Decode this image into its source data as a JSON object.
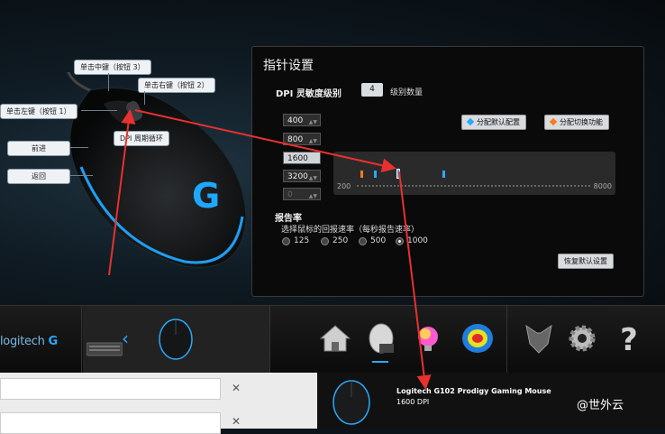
{
  "callouts": {
    "left_button": "单击左键（按钮 1）",
    "middle_button": "单击中键（按钮 3）",
    "right_button": "单击右键（按钮 2）",
    "dpi_cycle": "DPI 周期循环",
    "forward": "前进",
    "back": "返回"
  },
  "panel": {
    "title": "指针设置",
    "dpi_level_label": "DPI 灵敏度级别",
    "dpi_count": "4",
    "dpi_count_label": "级别数量",
    "dpi_levels": [
      "400",
      "800",
      "1600",
      "3200",
      "0"
    ],
    "selected_level_index": 2,
    "assign_default_label": "分配默认配置",
    "assign_shift_label": "分配切换功能",
    "slider_min": "200",
    "slider_max": "8000",
    "report_rate_title": "报告率",
    "report_rate_sub": "选择鼠标的回报速率（每秒报告速率）",
    "rates": [
      "125",
      "250",
      "500",
      "1000"
    ],
    "selected_rate": "1000",
    "restore_default_label": "恢复默认设置"
  },
  "bottom_bar": {
    "logo_text": "logitech",
    "icons": [
      "home-icon",
      "mouse-pointer-settings-icon",
      "lighting-icon",
      "heatmap-icon",
      "arx-control-icon",
      "settings-gear-icon",
      "help-icon"
    ]
  },
  "notification": {
    "device_name": "Logitech G102 Prodigy Gaming Mouse",
    "dpi_text": "1600 DPI"
  },
  "watermark": "@世外云",
  "colors": {
    "accent": "#2aa9ff",
    "shift_orange": "#ff7a1a",
    "annotation_red": "#e8312e"
  }
}
